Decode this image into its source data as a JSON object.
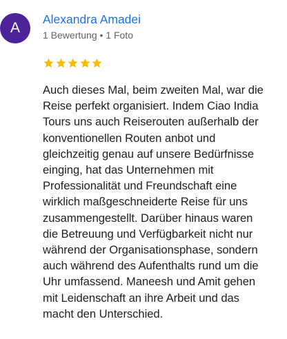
{
  "review": {
    "avatar_initial": "A",
    "author_name": "Alexandra Amadei",
    "author_meta": "1 Bewertung • 1 Foto",
    "rating": 5,
    "star_color": "#fbbc04",
    "avatar_color": "#4c2398",
    "name_color": "#1a73e8",
    "icons": [
      "star-icon"
    ],
    "text": "Auch dieses Mal, beim zweiten Mal, war die\nReise perfekt organisiert. Indem Ciao India\nTours uns auch Reiserouten außerhalb der\nkonventionellen Routen anbot und\ngleichzeitig genau auf unsere Bedürfnisse\neinging, hat das Unternehmen mit\nProfessionalität und Freundschaft eine\nwirklich maßgeschneiderte Reise für uns\nzusammengestellt. Darüber hinaus waren\ndie Betreuung und Verfügbarkeit nicht nur\nwährend der Organisationsphase, sondern\nauch während des Aufenthalts rund um die\nUhr umfassend. Maneesh und Amit gehen\nmit Leidenschaft an ihre Arbeit und das\nmacht den Unterschied."
  }
}
